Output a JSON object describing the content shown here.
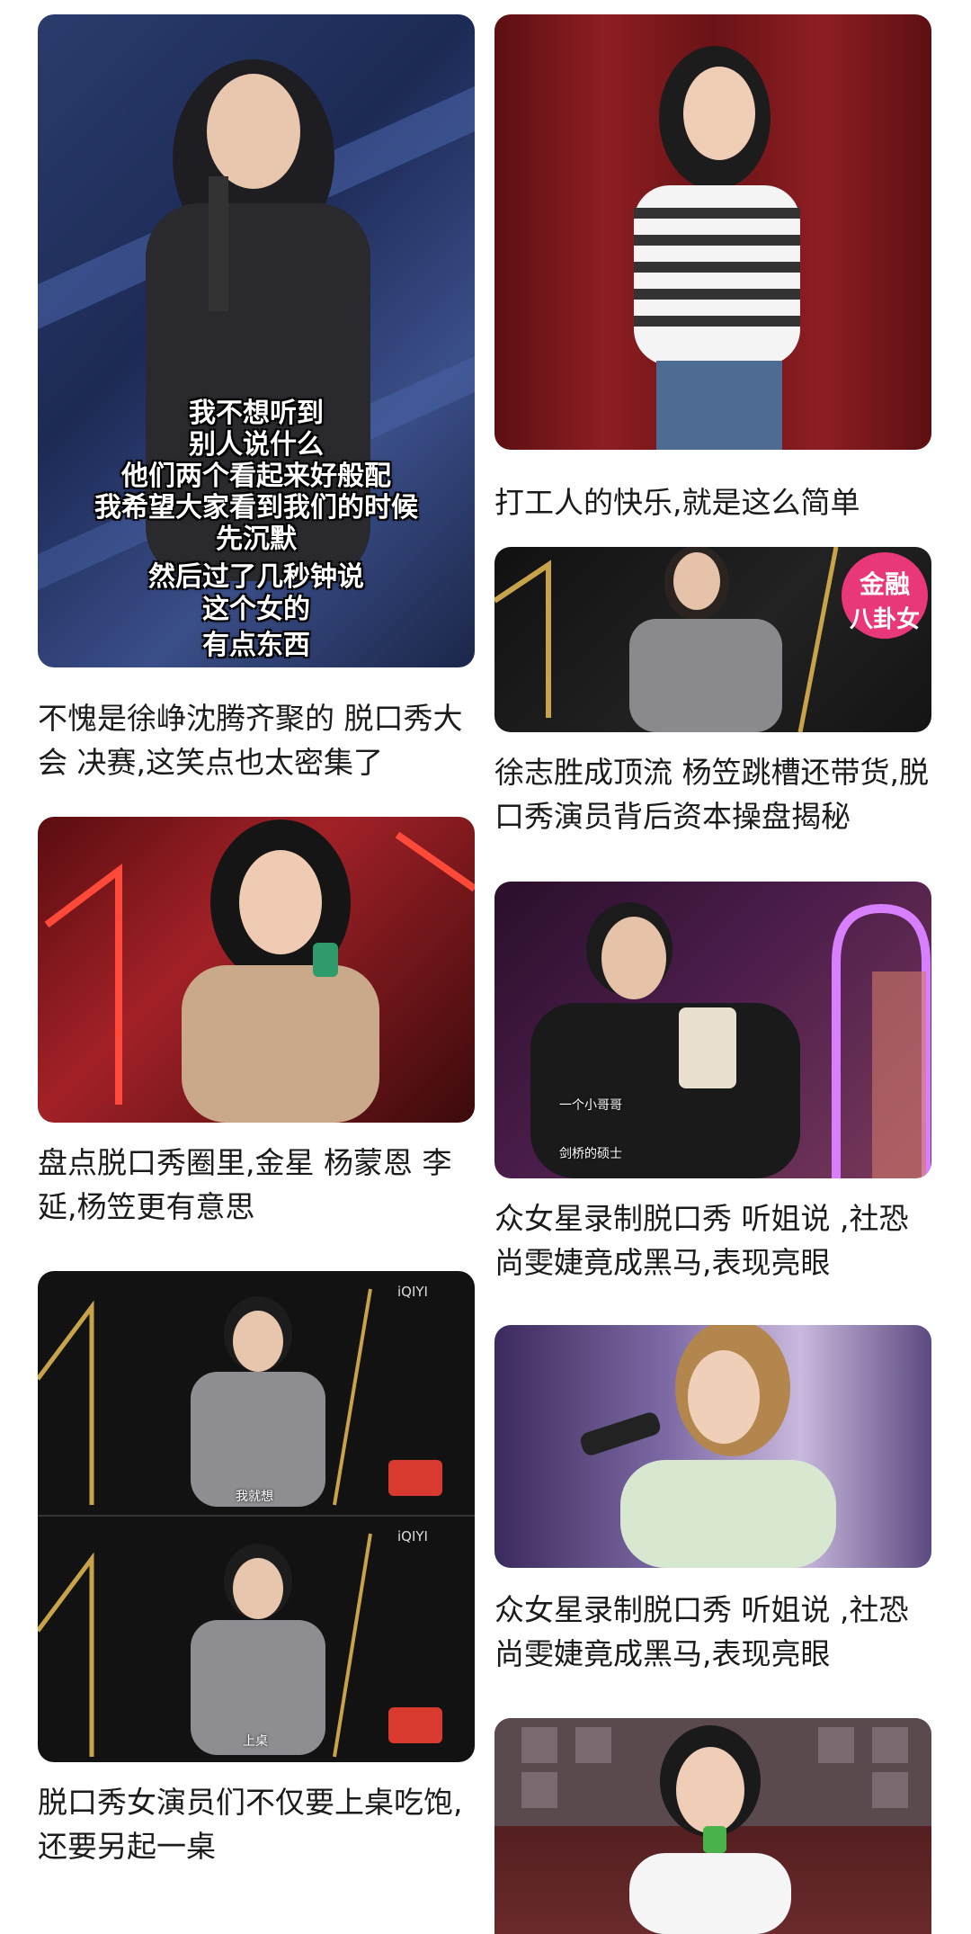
{
  "feed": {
    "cards": [
      {
        "title": "不愧是徐峥沈腾齐聚的 脱口秀大会 决赛,这笑点也太密集了",
        "overlay_lines": [
          "我不想听到",
          "别人说什么",
          "他们两个看起来好般配",
          "我希望大家看到我们的时候",
          "先沉默",
          "然后过了几秒钟说",
          "这个女的",
          "有点东西"
        ]
      },
      {
        "title": "打工人的快乐,就是这么简单"
      },
      {
        "title": "徐志胜成顶流 杨笠跳槽还带货,脱口秀演员背后资本操盘揭秘",
        "badge_line1": "金融",
        "badge_line2": "八卦女"
      },
      {
        "title": "盘点脱口秀圈里,金星 杨蒙恩 李延,杨笠更有意思"
      },
      {
        "title": "众女星录制脱口秀 听姐说 ,社恐尚雯婕竟成黑马,表现亮眼",
        "subtitle1": "一个小哥哥",
        "subtitle2": "剑桥的硕士"
      },
      {
        "title": "脱口秀女演员们不仅要上桌吃饱,还要另起一桌",
        "logo": "iQIYI",
        "subtitle_top": "我就想",
        "subtitle_bottom": "上桌"
      },
      {
        "title": "众女星录制脱口秀 听姐说 ,社恐尚雯婕竟成黑马,表现亮眼"
      },
      {
        "title": ""
      }
    ]
  },
  "colors": {
    "background": "#ffffff",
    "title_text": "#1b1b1b",
    "badge": "#e8387a"
  }
}
